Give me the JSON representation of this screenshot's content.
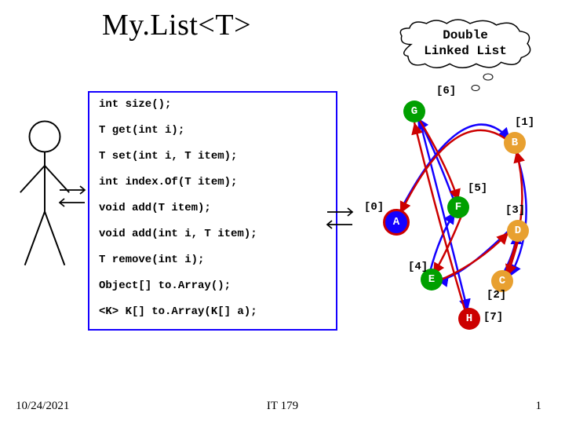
{
  "title": "My.List<T>",
  "cloud": {
    "line1": "Double",
    "line2": "Linked List"
  },
  "api": {
    "rows": [
      "int size();",
      "T get(int i);",
      "T set(int i, T item);",
      "int index.Of(T item);",
      "void add(T item);",
      "void add(int i, T item);",
      "T remove(int i);",
      "Object[] to.Array();",
      "<K> K[] to.Array(K[] a);"
    ]
  },
  "nodes": {
    "G": {
      "letter": "G",
      "idx": "[6]",
      "color": "green"
    },
    "B": {
      "letter": "B",
      "idx": "[1]",
      "color": "orange"
    },
    "F": {
      "letter": "F",
      "idx": "[5]",
      "color": "green"
    },
    "A": {
      "letter": "A",
      "idx": "[0]",
      "color": "blue"
    },
    "D": {
      "letter": "D",
      "idx": "[3]",
      "color": "orange"
    },
    "E": {
      "letter": "E",
      "idx": "[4]",
      "color": "green"
    },
    "C": {
      "letter": "C",
      "idx": "[2]",
      "color": "orange"
    },
    "H": {
      "letter": "H",
      "idx": "[7]",
      "color": "red"
    }
  },
  "footer": {
    "date": "10/24/2021",
    "center": "IT 179",
    "page": "1"
  }
}
